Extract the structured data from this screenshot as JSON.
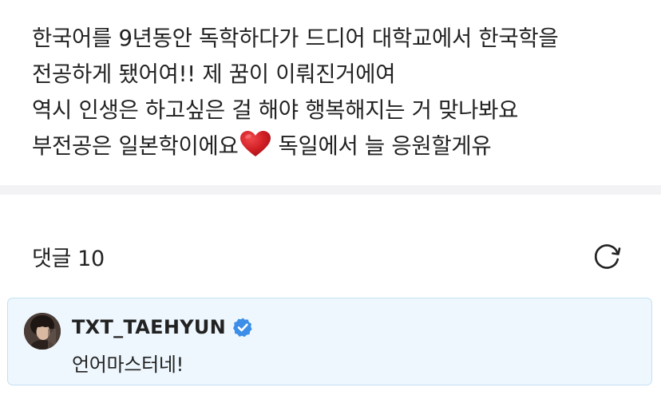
{
  "post": {
    "lines": [
      "한국어를 9년동안 독학하다가 드디어 대학교에서 한국학을",
      "전공하게 됐어여!! 제 꿈이 이뤄진거에여",
      "역시 인생은 하고싶은 걸 해야 행복해지는 거 맞나봐요"
    ],
    "last_line_before_emoji": "부전공은 일본학이에요",
    "emoji": "red-heart-emoji",
    "last_line_after_emoji": "독일에서 늘 응원할게유"
  },
  "comments": {
    "title": "댓글",
    "count": "10",
    "refresh_icon": "refresh-icon",
    "items": [
      {
        "author": "TXT_TAEHYUN",
        "verified": true,
        "verified_icon": "verified-badge-icon",
        "text": "언어마스터네!",
        "highlight_color": "#eef7fd",
        "border_color": "#c3e1f3"
      }
    ]
  },
  "colors": {
    "text": "#222222",
    "divider": "#f3f3f5",
    "verified_blue": "#3d8ee8",
    "heart_red": "#d11f24"
  }
}
